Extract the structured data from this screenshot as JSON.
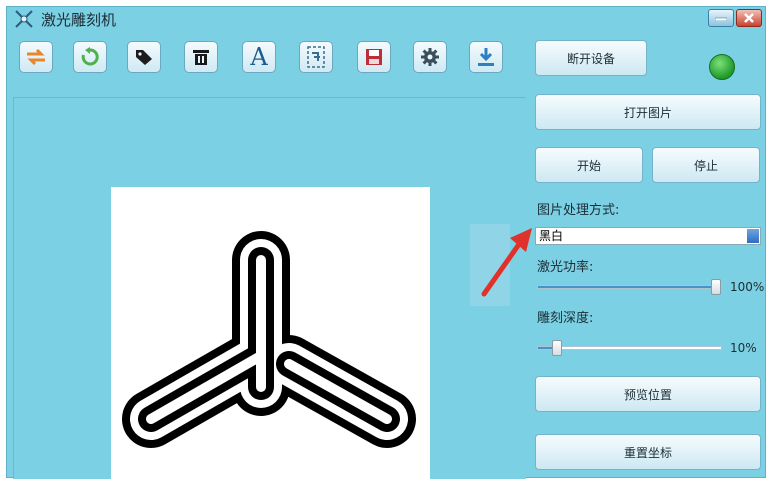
{
  "window": {
    "title": "激光雕刻机"
  },
  "toolbar": {
    "items": [
      {
        "icon": "swap-arrows-icon"
      },
      {
        "icon": "rotate-icon"
      },
      {
        "icon": "tag-icon"
      },
      {
        "icon": "trash-icon"
      },
      {
        "icon": "text-icon",
        "glyph": "A"
      },
      {
        "icon": "crop-icon"
      },
      {
        "icon": "save-icon"
      },
      {
        "icon": "settings-icon"
      },
      {
        "icon": "download-icon"
      }
    ]
  },
  "right_panel": {
    "disconnect_label": "断开设备",
    "connection_status_color": "#22a52b",
    "open_image_label": "打开图片",
    "start_label": "开始",
    "stop_label": "停止",
    "processing_label": "图片处理方式:",
    "processing_value": "黑白",
    "laser_power_label": "激光功率:",
    "laser_power_value": "100%",
    "laser_power_fraction": 1.0,
    "engrave_depth_label": "雕刻深度:",
    "engrave_depth_value": "10%",
    "engrave_depth_fraction": 0.1,
    "preview_label": "预览位置",
    "reset_label": "重置坐标"
  },
  "colors": {
    "window_bg": "#7cd0e3",
    "annotation_arrow": "#e0322b"
  }
}
